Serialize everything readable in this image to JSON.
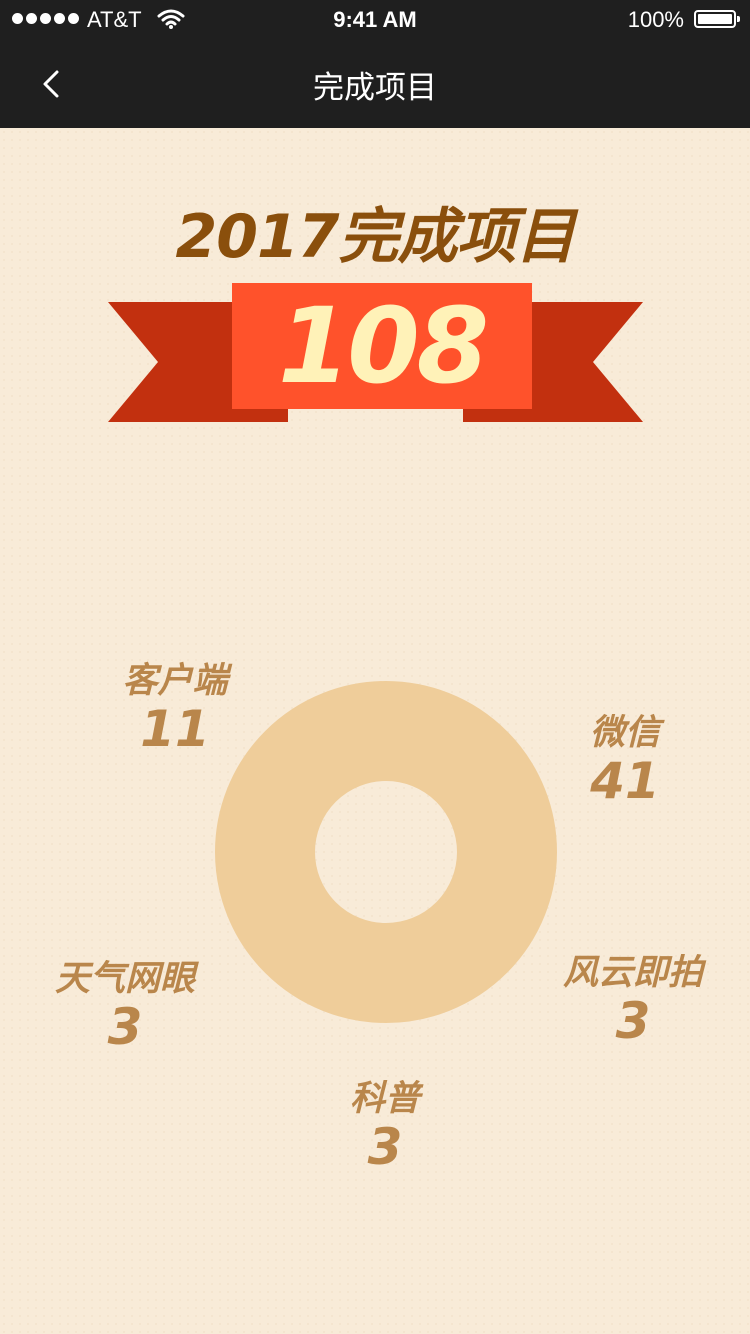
{
  "status_bar": {
    "carrier": "AT&T",
    "time": "9:41 AM",
    "battery": "100%"
  },
  "nav": {
    "title": "完成项目"
  },
  "headline": "2017完成项目",
  "total": "108",
  "colors": {
    "nav_background": "#1f1f1f",
    "page_background": "#f8ebd8",
    "headline": "#8a4f0c",
    "ribbon_front": "#ff522b",
    "ribbon_back": "#c2300f",
    "number": "#fff2b8",
    "donut": "#efcd9a",
    "label": "#b9864b"
  },
  "categories": [
    {
      "name": "客户端",
      "value": "11"
    },
    {
      "name": "微信",
      "value": "41"
    },
    {
      "name": "天气网眼",
      "value": "3"
    },
    {
      "name": "风云即拍",
      "value": "3"
    },
    {
      "name": "科普",
      "value": "3"
    }
  ]
}
